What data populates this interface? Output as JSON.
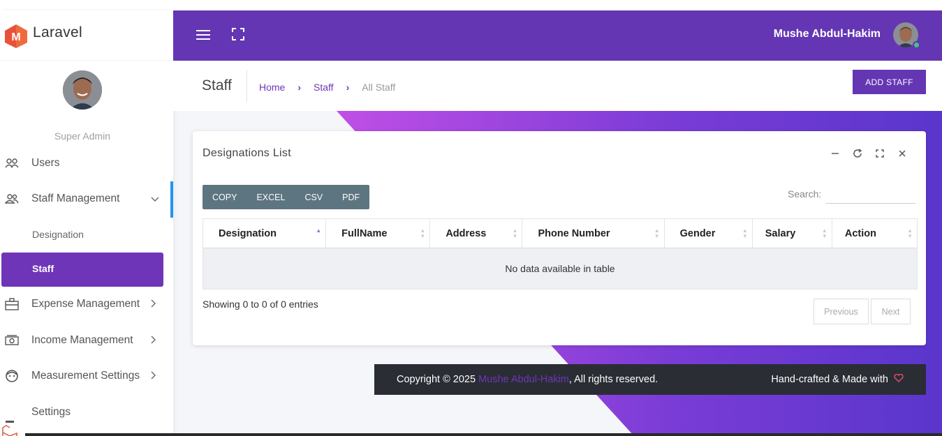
{
  "brand": {
    "name": "Laravel",
    "logo_letter": "M"
  },
  "sidebar": {
    "role": "Super Admin",
    "items": [
      {
        "label": "Users",
        "icon": "users-icon"
      },
      {
        "label": "Staff Management",
        "icon": "staff-icon"
      },
      {
        "label": "Expense Management",
        "icon": "briefcase-icon"
      },
      {
        "label": "Income Management",
        "icon": "cash-icon"
      },
      {
        "label": "Measurement Settings",
        "icon": "face-icon"
      },
      {
        "label": "Settings",
        "icon": "settings-icon"
      }
    ],
    "sub_items": [
      {
        "label": "Designation"
      },
      {
        "label": "Staff"
      }
    ]
  },
  "header": {
    "user_name": "Mushe Abdul-Hakim"
  },
  "page": {
    "title": "Staff",
    "breadcrumb": [
      "Home",
      "Staff",
      "All Staff"
    ],
    "add_button": "ADD STAFF"
  },
  "card": {
    "title": "Designations List",
    "export_buttons": [
      "COPY",
      "EXCEL",
      "CSV",
      "PDF"
    ],
    "search_label": "Search:",
    "search_value": "",
    "columns": [
      "Designation",
      "FullName",
      "Address",
      "Phone Number",
      "Gender",
      "Salary",
      "Action"
    ],
    "empty_text": "No data available in table",
    "info": "Showing 0 to 0 of 0 entries",
    "prev": "Previous",
    "next": "Next"
  },
  "footer": {
    "copyright": "Copyright © 2025",
    "author": "Mushe Abdul-Hakim",
    "rights": ", All rights reserved.",
    "made_with": "Hand-crafted & Made with"
  },
  "colors": {
    "primary": "#6436b3",
    "accent": "#6f35b8",
    "gradient_start": "#b84fe0",
    "active_bar": "#2196f3"
  }
}
